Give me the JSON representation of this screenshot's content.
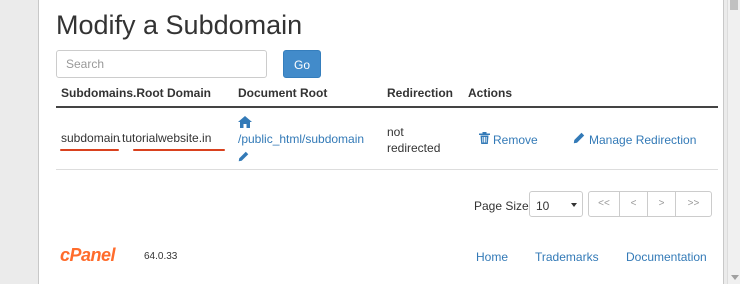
{
  "page": {
    "title": "Modify a Subdomain"
  },
  "search": {
    "placeholder": "Search",
    "go_label": "Go"
  },
  "table": {
    "headers": [
      "Subdomains.Root Domain",
      "Document Root",
      "Redirection",
      "Actions"
    ],
    "row": {
      "subdomain": "subdomain",
      "dot": ".",
      "root_domain": "tutorialwebsite.in",
      "document_root": "/public_html/subdomain",
      "redirection_line1": "not",
      "redirection_line2": "redirected",
      "remove_label": "Remove",
      "manage_label": "Manage Redirection"
    }
  },
  "pagination": {
    "page_size_label": "Page Size",
    "page_size_value": "10",
    "buttons": [
      "<<",
      "<",
      ">",
      ">>"
    ]
  },
  "footer": {
    "logo_text": "cPanel",
    "version": "64.0.33",
    "links": [
      "Home",
      "Trademarks",
      "Documentation"
    ]
  },
  "colors": {
    "accent": "#428bca",
    "link": "#337ab7",
    "highlight": "#d9411e",
    "brand": "#ff6c2c"
  },
  "icons": {
    "home": "home-icon",
    "edit": "pencil-icon",
    "remove": "trash-icon"
  }
}
